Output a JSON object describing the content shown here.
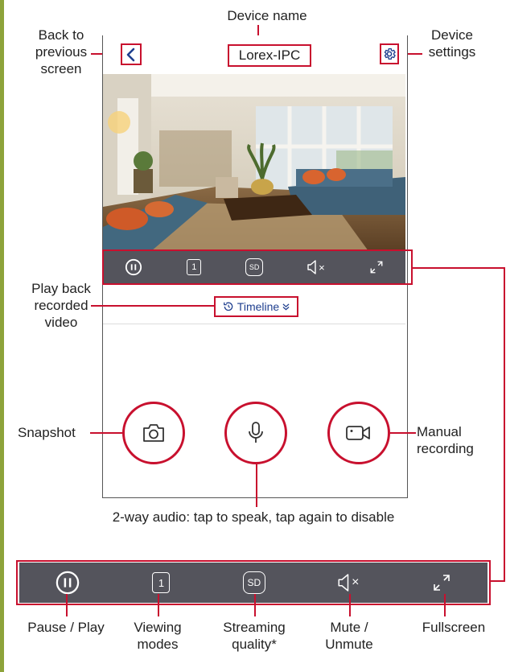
{
  "header": {
    "title": "Lorex-IPC"
  },
  "timeline": {
    "label": "Timeline"
  },
  "annotations": {
    "device_name": "Device name",
    "back": [
      "Back to",
      "previous",
      "screen"
    ],
    "settings": [
      "Device",
      "settings"
    ],
    "playback": [
      "Play back",
      "recorded",
      "video"
    ],
    "snapshot": "Snapshot",
    "manual_recording": [
      "Manual",
      "recording"
    ],
    "two_way_audio": "2-way audio: tap to speak, tap again to disable",
    "pause_play": "Pause / Play",
    "viewing_modes": [
      "Viewing",
      "modes"
    ],
    "streaming_quality": [
      "Streaming",
      "quality*"
    ],
    "mute": [
      "Mute /",
      "Unmute"
    ],
    "fullscreen": "Fullscreen"
  },
  "controls": {
    "viewing_mode_value": "1",
    "quality_value": "SD",
    "mute_symbol": "×"
  },
  "colors": {
    "accent": "#c8102e",
    "bar": "#54545c",
    "link": "#1f3f8f",
    "sidebar": "#8da33a"
  }
}
